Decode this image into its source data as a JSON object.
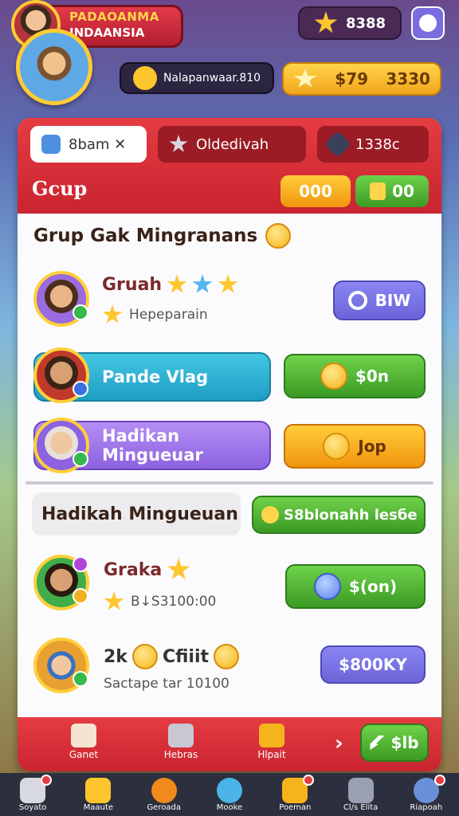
{
  "header": {
    "title_line1": "PADAOANMA",
    "title_line2": "INDAANSIA",
    "coins": "8388",
    "player_name": "Nalapanwaar.810",
    "gold_left": "$79",
    "gold_right": "3330"
  },
  "tabs": [
    {
      "label": "8bam ✕"
    },
    {
      "label": "Oldedivah"
    },
    {
      "label": "1338c"
    }
  ],
  "group": {
    "label": "Gcup",
    "btn_orange": "000",
    "btn_green": "00"
  },
  "section1": {
    "heading": "Grup Gak Mingranans"
  },
  "rows": [
    {
      "name": "Gruah",
      "sub": "Hepeparain",
      "action": "BIW"
    },
    {
      "name": "Pande Vlag",
      "action": "$0n"
    },
    {
      "name": "Hadikan Mingueuar",
      "action": "Jop"
    }
  ],
  "section2": {
    "tab_label": "Hadikah Mingueuan",
    "search_label": "S8blonahh lesбe"
  },
  "rows2": [
    {
      "name": "Graka",
      "sub": "B↓S3100:00",
      "action": "$(on)"
    },
    {
      "name": "2k",
      "name_suffix": "Cfiiit",
      "sub": "Sactape tar 10100",
      "action": "$800KY"
    }
  ],
  "card_footer": [
    {
      "label": "Ganet"
    },
    {
      "label": "Hebras"
    },
    {
      "label": "Hlpait"
    }
  ],
  "footer_go": "$lb",
  "bottom_nav": [
    {
      "label": "Soyato"
    },
    {
      "label": "Maaute"
    },
    {
      "label": "Geroada"
    },
    {
      "label": "Mooke"
    },
    {
      "label": "Poeman"
    },
    {
      "label": "Cl/s Elita"
    },
    {
      "label": "Riapoah"
    }
  ],
  "colors": {
    "header_red": "#e53c43",
    "accent_gold": "#ffc52e",
    "green": "#3b9a24",
    "purple": "#6b64d8",
    "cyan": "#1f9ec4",
    "violet": "#8d62e0",
    "nav_bg": "#2c2f3d"
  }
}
